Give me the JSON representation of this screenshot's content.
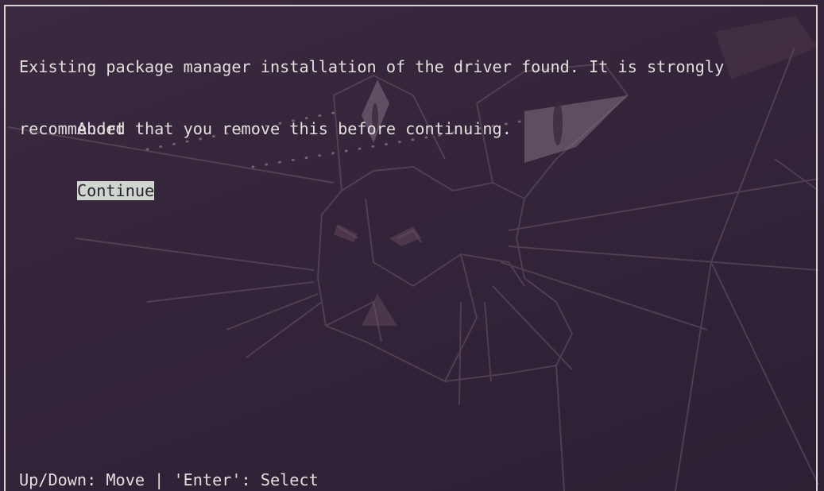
{
  "dialog": {
    "message_lines": [
      "Existing package manager installation of the driver found. It is strongly",
      "recommended that you remove this before continuing."
    ],
    "options": [
      {
        "label": "Abort",
        "selected": false
      },
      {
        "label": "Continue",
        "selected": true
      }
    ],
    "hint": "Up/Down: Move | 'Enter': Select"
  },
  "colors": {
    "background": "#33243a",
    "text": "#e2dfdc",
    "highlight_bg": "#cfd6cf",
    "highlight_fg": "#2a2030",
    "frame": "#d8d4d2"
  }
}
